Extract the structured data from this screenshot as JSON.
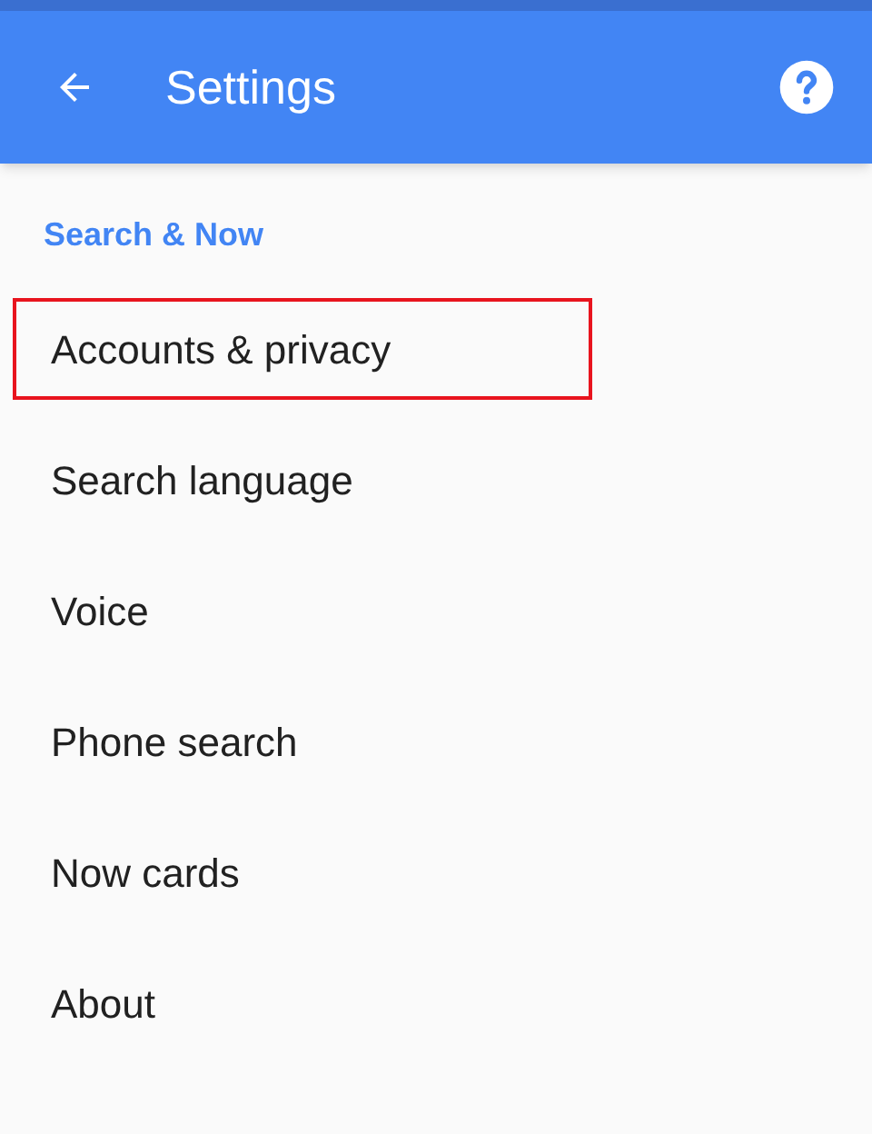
{
  "app_bar": {
    "title": "Settings"
  },
  "section": {
    "title": "Search & Now"
  },
  "items": [
    {
      "label": "Accounts & privacy",
      "highlighted": true
    },
    {
      "label": "Search language",
      "highlighted": false
    },
    {
      "label": "Voice",
      "highlighted": false
    },
    {
      "label": "Phone search",
      "highlighted": false
    },
    {
      "label": "Now cards",
      "highlighted": false
    },
    {
      "label": "About",
      "highlighted": false
    }
  ]
}
